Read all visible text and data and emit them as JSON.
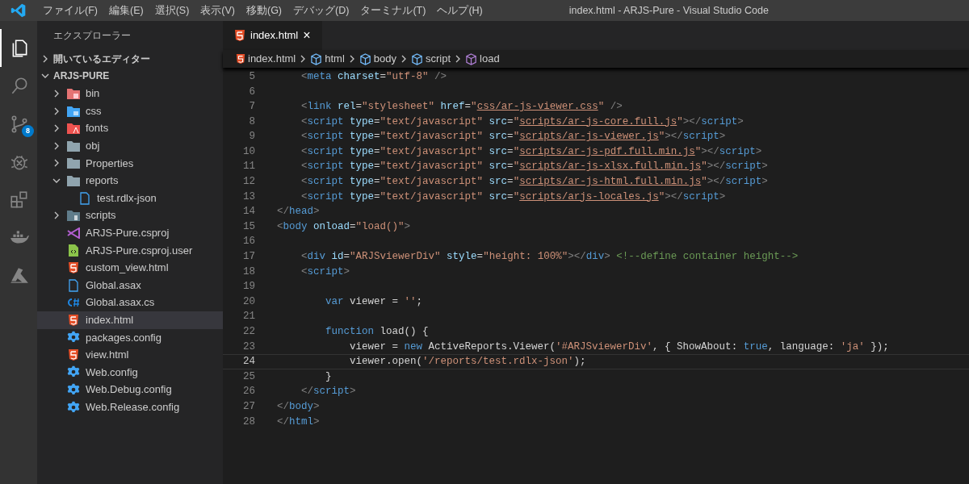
{
  "title_bar": {
    "menu": [
      "ファイル(F)",
      "編集(E)",
      "選択(S)",
      "表示(V)",
      "移動(G)",
      "デバッグ(D)",
      "ターミナル(T)",
      "ヘルプ(H)"
    ],
    "title": "index.html - ARJS-Pure - Visual Studio Code"
  },
  "activity_bar": [
    {
      "kind": "explorer",
      "selected": true
    },
    {
      "kind": "search",
      "selected": false
    },
    {
      "kind": "source-control",
      "selected": false,
      "badge": "8"
    },
    {
      "kind": "debug",
      "selected": false
    },
    {
      "kind": "extensions",
      "selected": false
    },
    {
      "kind": "docker",
      "selected": false
    },
    {
      "kind": "azure",
      "selected": false
    }
  ],
  "sidebar": {
    "title": "エクスプローラー",
    "sections": [
      {
        "label": "開いているエディター",
        "expanded": false
      },
      {
        "label": "ARJS-PURE",
        "expanded": true,
        "items": [
          {
            "label": "bin",
            "kind": "bin-folder",
            "expanded": false,
            "selected": false
          },
          {
            "label": "css",
            "kind": "css-folder",
            "expanded": false,
            "selected": false
          },
          {
            "label": "fonts",
            "kind": "fonts-folder",
            "expanded": false,
            "selected": false
          },
          {
            "label": "obj",
            "kind": "folder",
            "expanded": false,
            "selected": false
          },
          {
            "label": "Properties",
            "kind": "folder",
            "expanded": false,
            "selected": false
          },
          {
            "label": "reports",
            "kind": "folder",
            "expanded": true,
            "selected": false,
            "children": [
              {
                "label": "test.rdlx-json",
                "kind": "file",
                "selected": false
              }
            ]
          },
          {
            "label": "scripts",
            "kind": "scripts-folder",
            "expanded": false,
            "selected": false
          },
          {
            "label": "ARJS-Pure.csproj",
            "kind": "vs-project",
            "selected": false
          },
          {
            "label": "ARJS-Pure.csproj.user",
            "kind": "user-file",
            "selected": false
          },
          {
            "label": "custom_view.html",
            "kind": "html",
            "selected": false
          },
          {
            "label": "Global.asax",
            "kind": "file",
            "selected": false
          },
          {
            "label": "Global.asax.cs",
            "kind": "csharp",
            "selected": false
          },
          {
            "label": "index.html",
            "kind": "html",
            "selected": true
          },
          {
            "label": "packages.config",
            "kind": "config",
            "selected": false
          },
          {
            "label": "view.html",
            "kind": "html",
            "selected": false
          },
          {
            "label": "Web.config",
            "kind": "config",
            "selected": false
          },
          {
            "label": "Web.Debug.config",
            "kind": "config",
            "selected": false
          },
          {
            "label": "Web.Release.config",
            "kind": "config",
            "selected": false
          }
        ]
      }
    ]
  },
  "tabs": [
    {
      "label": "index.html",
      "close": "×",
      "selected": true
    }
  ],
  "breadcrumbs": [
    {
      "label": "index.html",
      "kind": "html"
    },
    {
      "label": "html",
      "kind": "element"
    },
    {
      "label": "body",
      "kind": "element"
    },
    {
      "label": "script",
      "kind": "element"
    },
    {
      "label": "load",
      "kind": "method"
    }
  ],
  "editor": {
    "lines": [
      {
        "number": "5",
        "current": false,
        "tokens": [
          {
            "kind": "punct",
            "text": "    <"
          },
          {
            "kind": "tag",
            "text": "meta"
          },
          {
            "kind": "attr",
            "text": " charset"
          },
          {
            "kind": "text",
            "text": "="
          },
          {
            "kind": "string",
            "text": "\"utf-8\""
          },
          {
            "kind": "punct",
            "text": " />"
          }
        ]
      },
      {
        "number": "6",
        "current": false
      },
      {
        "number": "7",
        "current": false,
        "tokens": [
          {
            "kind": "punct",
            "text": "    <"
          },
          {
            "kind": "tag",
            "text": "link"
          },
          {
            "kind": "attr",
            "text": " rel"
          },
          {
            "kind": "text",
            "text": "="
          },
          {
            "kind": "string",
            "text": "\"stylesheet\""
          },
          {
            "kind": "attr",
            "text": " href"
          },
          {
            "kind": "text",
            "text": "="
          },
          {
            "kind": "string",
            "text": "\""
          },
          {
            "kind": "link",
            "text": "css/ar-js-viewer.css"
          },
          {
            "kind": "string",
            "text": "\""
          },
          {
            "kind": "punct",
            "text": " />"
          }
        ]
      },
      {
        "number": "8",
        "current": false,
        "tokens": [
          {
            "kind": "punct",
            "text": "    <"
          },
          {
            "kind": "tag",
            "text": "script"
          },
          {
            "kind": "attr",
            "text": " type"
          },
          {
            "kind": "text",
            "text": "="
          },
          {
            "kind": "string",
            "text": "\"text/javascript\""
          },
          {
            "kind": "attr",
            "text": " src"
          },
          {
            "kind": "text",
            "text": "="
          },
          {
            "kind": "string",
            "text": "\""
          },
          {
            "kind": "link",
            "text": "scripts/ar-js-core.full.js"
          },
          {
            "kind": "string",
            "text": "\""
          },
          {
            "kind": "punct",
            "text": "></"
          },
          {
            "kind": "tag",
            "text": "script"
          },
          {
            "kind": "punct",
            "text": ">"
          }
        ]
      },
      {
        "number": "9",
        "current": false,
        "tokens": [
          {
            "kind": "punct",
            "text": "    <"
          },
          {
            "kind": "tag",
            "text": "script"
          },
          {
            "kind": "attr",
            "text": " type"
          },
          {
            "kind": "text",
            "text": "="
          },
          {
            "kind": "string",
            "text": "\"text/javascript\""
          },
          {
            "kind": "attr",
            "text": " src"
          },
          {
            "kind": "text",
            "text": "="
          },
          {
            "kind": "string",
            "text": "\""
          },
          {
            "kind": "link",
            "text": "scripts/ar-js-viewer.js"
          },
          {
            "kind": "string",
            "text": "\""
          },
          {
            "kind": "punct",
            "text": "></"
          },
          {
            "kind": "tag",
            "text": "script"
          },
          {
            "kind": "punct",
            "text": ">"
          }
        ]
      },
      {
        "number": "10",
        "current": false,
        "tokens": [
          {
            "kind": "punct",
            "text": "    <"
          },
          {
            "kind": "tag",
            "text": "script"
          },
          {
            "kind": "attr",
            "text": " type"
          },
          {
            "kind": "text",
            "text": "="
          },
          {
            "kind": "string",
            "text": "\"text/javascript\""
          },
          {
            "kind": "attr",
            "text": " src"
          },
          {
            "kind": "text",
            "text": "="
          },
          {
            "kind": "string",
            "text": "\""
          },
          {
            "kind": "link",
            "text": "scripts/ar-js-pdf.full.min.js"
          },
          {
            "kind": "string",
            "text": "\""
          },
          {
            "kind": "punct",
            "text": "></"
          },
          {
            "kind": "tag",
            "text": "script"
          },
          {
            "kind": "punct",
            "text": ">"
          }
        ]
      },
      {
        "number": "11",
        "current": false,
        "tokens": [
          {
            "kind": "punct",
            "text": "    <"
          },
          {
            "kind": "tag",
            "text": "script"
          },
          {
            "kind": "attr",
            "text": " type"
          },
          {
            "kind": "text",
            "text": "="
          },
          {
            "kind": "string",
            "text": "\"text/javascript\""
          },
          {
            "kind": "attr",
            "text": " src"
          },
          {
            "kind": "text",
            "text": "="
          },
          {
            "kind": "string",
            "text": "\""
          },
          {
            "kind": "link",
            "text": "scripts/ar-js-xlsx.full.min.js"
          },
          {
            "kind": "string",
            "text": "\""
          },
          {
            "kind": "punct",
            "text": "></"
          },
          {
            "kind": "tag",
            "text": "script"
          },
          {
            "kind": "punct",
            "text": ">"
          }
        ]
      },
      {
        "number": "12",
        "current": false,
        "tokens": [
          {
            "kind": "punct",
            "text": "    <"
          },
          {
            "kind": "tag",
            "text": "script"
          },
          {
            "kind": "attr",
            "text": " type"
          },
          {
            "kind": "text",
            "text": "="
          },
          {
            "kind": "string",
            "text": "\"text/javascript\""
          },
          {
            "kind": "attr",
            "text": " src"
          },
          {
            "kind": "text",
            "text": "="
          },
          {
            "kind": "string",
            "text": "\""
          },
          {
            "kind": "link",
            "text": "scripts/ar-js-html.full.min.js"
          },
          {
            "kind": "string",
            "text": "\""
          },
          {
            "kind": "punct",
            "text": "></"
          },
          {
            "kind": "tag",
            "text": "script"
          },
          {
            "kind": "punct",
            "text": ">"
          }
        ]
      },
      {
        "number": "13",
        "current": false,
        "tokens": [
          {
            "kind": "punct",
            "text": "    <"
          },
          {
            "kind": "tag",
            "text": "script"
          },
          {
            "kind": "attr",
            "text": " type"
          },
          {
            "kind": "text",
            "text": "="
          },
          {
            "kind": "string",
            "text": "\"text/javascript\""
          },
          {
            "kind": "attr",
            "text": " src"
          },
          {
            "kind": "text",
            "text": "="
          },
          {
            "kind": "string",
            "text": "\""
          },
          {
            "kind": "link",
            "text": "scripts/arjs-locales.js"
          },
          {
            "kind": "string",
            "text": "\""
          },
          {
            "kind": "punct",
            "text": "></"
          },
          {
            "kind": "tag",
            "text": "script"
          },
          {
            "kind": "punct",
            "text": ">"
          }
        ]
      },
      {
        "number": "14",
        "current": false,
        "tokens": [
          {
            "kind": "punct",
            "text": "</"
          },
          {
            "kind": "tag",
            "text": "head"
          },
          {
            "kind": "punct",
            "text": ">"
          }
        ]
      },
      {
        "number": "15",
        "current": false,
        "tokens": [
          {
            "kind": "punct",
            "text": "<"
          },
          {
            "kind": "tag",
            "text": "body"
          },
          {
            "kind": "attr",
            "text": " onload"
          },
          {
            "kind": "text",
            "text": "="
          },
          {
            "kind": "string",
            "text": "\"load()\""
          },
          {
            "kind": "punct",
            "text": ">"
          }
        ]
      },
      {
        "number": "16",
        "current": false
      },
      {
        "number": "17",
        "current": false,
        "tokens": [
          {
            "kind": "punct",
            "text": "    <"
          },
          {
            "kind": "tag",
            "text": "div"
          },
          {
            "kind": "attr",
            "text": " id"
          },
          {
            "kind": "text",
            "text": "="
          },
          {
            "kind": "string",
            "text": "\"ARJSviewerDiv\""
          },
          {
            "kind": "attr",
            "text": " style"
          },
          {
            "kind": "text",
            "text": "="
          },
          {
            "kind": "string",
            "text": "\"height: 100%\""
          },
          {
            "kind": "punct",
            "text": "></"
          },
          {
            "kind": "tag",
            "text": "div"
          },
          {
            "kind": "punct",
            "text": ">"
          },
          {
            "kind": "comment",
            "text": " <!--define container height-->"
          }
        ]
      },
      {
        "number": "18",
        "current": false,
        "tokens": [
          {
            "kind": "punct",
            "text": "    <"
          },
          {
            "kind": "tag",
            "text": "script"
          },
          {
            "kind": "punct",
            "text": ">"
          }
        ]
      },
      {
        "number": "19",
        "current": false
      },
      {
        "number": "20",
        "current": false,
        "tokens": [
          {
            "kind": "keyword",
            "text": "        var"
          },
          {
            "kind": "text",
            "text": " viewer = "
          },
          {
            "kind": "string",
            "text": "''"
          },
          {
            "kind": "text",
            "text": ";"
          }
        ]
      },
      {
        "number": "21",
        "current": false
      },
      {
        "number": "22",
        "current": false,
        "tokens": [
          {
            "kind": "keyword",
            "text": "        function"
          },
          {
            "kind": "text",
            "text": " load() {"
          }
        ]
      },
      {
        "number": "23",
        "current": false,
        "tokens": [
          {
            "kind": "text",
            "text": "            viewer = "
          },
          {
            "kind": "keyword",
            "text": "new"
          },
          {
            "kind": "text",
            "text": " ActiveReports.Viewer("
          },
          {
            "kind": "string",
            "text": "'#ARJSviewerDiv'"
          },
          {
            "kind": "text",
            "text": ", { ShowAbout: "
          },
          {
            "kind": "keyword",
            "text": "true"
          },
          {
            "kind": "text",
            "text": ", language: "
          },
          {
            "kind": "string",
            "text": "'ja'"
          },
          {
            "kind": "text",
            "text": " });"
          }
        ]
      },
      {
        "number": "24",
        "current": true,
        "tokens": [
          {
            "kind": "text",
            "text": "            viewer.open("
          },
          {
            "kind": "string",
            "text": "'/reports/test.rdlx-json'"
          },
          {
            "kind": "text",
            "text": ");"
          }
        ]
      },
      {
        "number": "25",
        "current": false,
        "tokens": [
          {
            "kind": "text",
            "text": "        }"
          }
        ]
      },
      {
        "number": "26",
        "current": false,
        "tokens": [
          {
            "kind": "punct",
            "text": "    </"
          },
          {
            "kind": "tag",
            "text": "script"
          },
          {
            "kind": "punct",
            "text": ">"
          }
        ]
      },
      {
        "number": "27",
        "current": false,
        "tokens": [
          {
            "kind": "punct",
            "text": "</"
          },
          {
            "kind": "tag",
            "text": "body"
          },
          {
            "kind": "punct",
            "text": ">"
          }
        ]
      },
      {
        "number": "28",
        "current": false,
        "tokens": [
          {
            "kind": "punct",
            "text": "</"
          },
          {
            "kind": "tag",
            "text": "html"
          },
          {
            "kind": "punct",
            "text": ">"
          }
        ]
      }
    ]
  }
}
